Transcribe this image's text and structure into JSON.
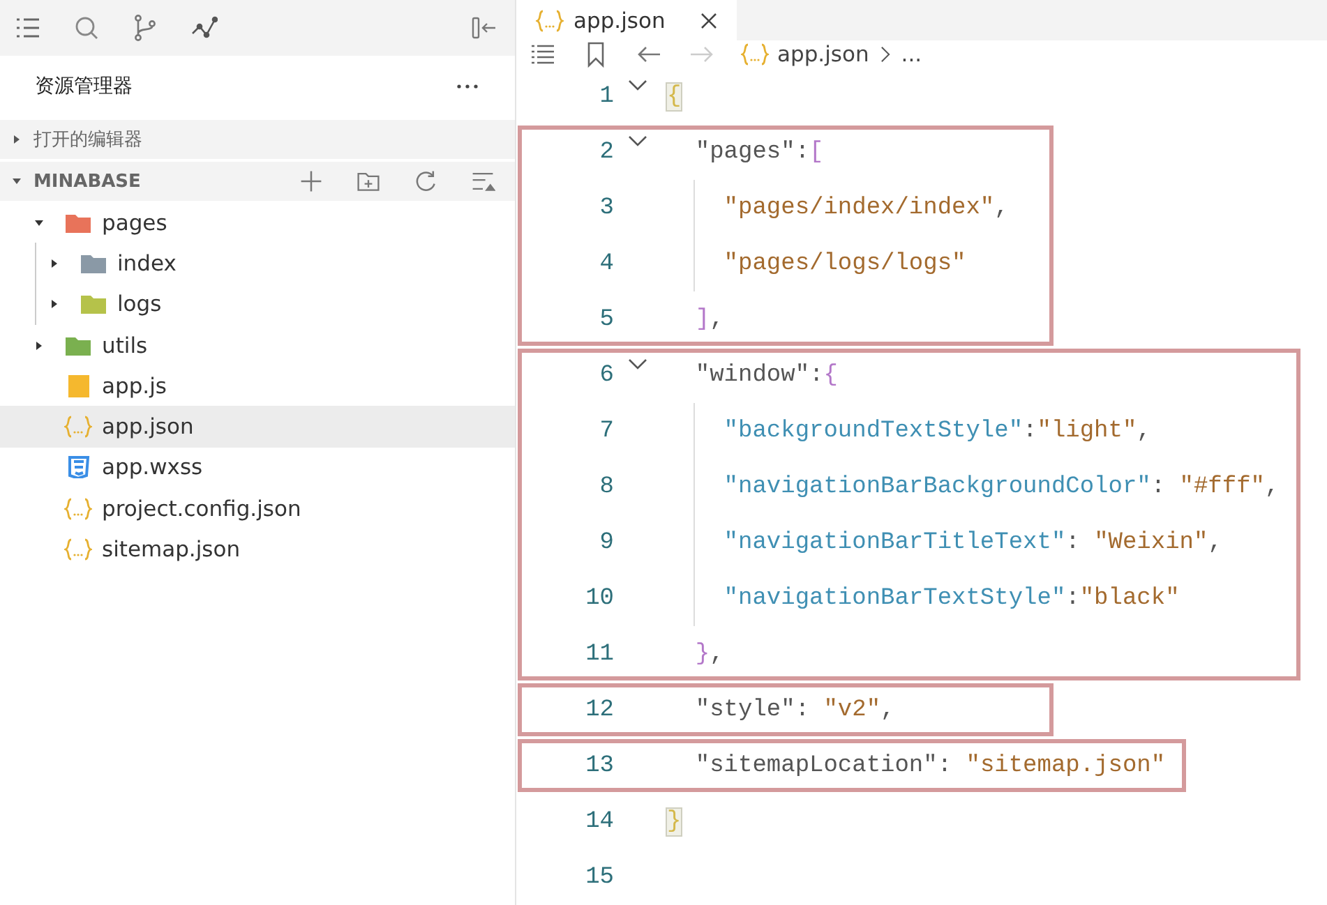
{
  "explorer": {
    "title": "资源管理器",
    "sections": [
      {
        "label": "打开的编辑器",
        "expanded": false
      },
      {
        "label": "MINABASE",
        "expanded": true
      }
    ]
  },
  "tree": [
    {
      "name": "pages",
      "kind": "folder-pages",
      "expanded": true,
      "selected": false,
      "children": [
        {
          "name": "index",
          "kind": "folder",
          "expanded": false,
          "selected": false
        },
        {
          "name": "logs",
          "kind": "folder-logs",
          "expanded": false,
          "selected": false
        }
      ]
    },
    {
      "name": "utils",
      "kind": "folder-utils",
      "expanded": false,
      "selected": false
    },
    {
      "name": "app.js",
      "kind": "js",
      "selected": false
    },
    {
      "name": "app.json",
      "kind": "json",
      "selected": true
    },
    {
      "name": "app.wxss",
      "kind": "css",
      "selected": false
    },
    {
      "name": "project.config.json",
      "kind": "json",
      "selected": false
    },
    {
      "name": "sitemap.json",
      "kind": "json",
      "selected": false
    }
  ],
  "tabs": [
    {
      "label": "app.json",
      "kind": "json",
      "selected": true
    }
  ],
  "breadcrumb": {
    "file": "app.json",
    "kind": "json",
    "tail": "..."
  },
  "code": {
    "blocks": [
      {
        "highlighted": false,
        "lines": [
          {
            "number": "1",
            "foldable": true,
            "indent_guide": false,
            "tokens": [
              {
                "kind": "bracket-match",
                "text": "{"
              }
            ]
          }
        ]
      },
      {
        "highlighted": true,
        "lines": [
          {
            "number": "2",
            "foldable": true,
            "indent_guide": false,
            "tokens": [
              {
                "kind": "key",
                "text": "  \"pages\""
              },
              {
                "kind": "punct",
                "text": ":"
              },
              {
                "kind": "bracket",
                "text": "["
              }
            ]
          },
          {
            "number": "3",
            "foldable": false,
            "indent_guide": true,
            "tokens": [
              {
                "kind": "string",
                "text": "    \"pages/index/index\""
              },
              {
                "kind": "punct",
                "text": ","
              }
            ]
          },
          {
            "number": "4",
            "foldable": false,
            "indent_guide": true,
            "tokens": [
              {
                "kind": "string",
                "text": "    \"pages/logs/logs\""
              }
            ]
          },
          {
            "number": "5",
            "foldable": false,
            "indent_guide": false,
            "tokens": [
              {
                "kind": "bracket",
                "text": "  ]"
              },
              {
                "kind": "punct",
                "text": ","
              }
            ]
          }
        ]
      },
      {
        "highlighted": true,
        "lines": [
          {
            "number": "6",
            "foldable": true,
            "indent_guide": false,
            "tokens": [
              {
                "kind": "key",
                "text": "  \"window\""
              },
              {
                "kind": "punct",
                "text": ":"
              },
              {
                "kind": "bracket",
                "text": "{"
              }
            ]
          },
          {
            "number": "7",
            "foldable": false,
            "indent_guide": true,
            "tokens": [
              {
                "kind": "prop",
                "text": "    \"backgroundTextStyle\""
              },
              {
                "kind": "punct",
                "text": ":"
              },
              {
                "kind": "string",
                "text": "\"light\""
              },
              {
                "kind": "punct",
                "text": ","
              }
            ]
          },
          {
            "number": "8",
            "foldable": false,
            "indent_guide": true,
            "tokens": [
              {
                "kind": "prop",
                "text": "    \"navigationBarBackgroundColor\""
              },
              {
                "kind": "punct",
                "text": ": "
              },
              {
                "kind": "string",
                "text": "\"#fff\""
              },
              {
                "kind": "punct",
                "text": ","
              }
            ]
          },
          {
            "number": "9",
            "foldable": false,
            "indent_guide": true,
            "tokens": [
              {
                "kind": "prop",
                "text": "    \"navigationBarTitleText\""
              },
              {
                "kind": "punct",
                "text": ": "
              },
              {
                "kind": "string",
                "text": "\"Weixin\""
              },
              {
                "kind": "punct",
                "text": ","
              }
            ]
          },
          {
            "number": "10",
            "foldable": false,
            "indent_guide": true,
            "tokens": [
              {
                "kind": "prop",
                "text": "    \"navigationBarTextStyle\""
              },
              {
                "kind": "punct",
                "text": ":"
              },
              {
                "kind": "string",
                "text": "\"black\""
              }
            ]
          },
          {
            "number": "11",
            "foldable": false,
            "indent_guide": false,
            "tokens": [
              {
                "kind": "bracket",
                "text": "  }"
              },
              {
                "kind": "punct",
                "text": ","
              }
            ]
          }
        ]
      },
      {
        "highlighted": true,
        "lines": [
          {
            "number": "12",
            "foldable": false,
            "indent_guide": false,
            "tokens": [
              {
                "kind": "key",
                "text": "  \"style\""
              },
              {
                "kind": "punct",
                "text": ": "
              },
              {
                "kind": "string",
                "text": "\"v2\""
              },
              {
                "kind": "punct",
                "text": ","
              }
            ]
          }
        ]
      },
      {
        "highlighted": true,
        "lines": [
          {
            "number": "13",
            "foldable": false,
            "indent_guide": false,
            "tokens": [
              {
                "kind": "key",
                "text": "  \"sitemapLocation\""
              },
              {
                "kind": "punct",
                "text": ": "
              },
              {
                "kind": "string",
                "text": "\"sitemap.json\""
              }
            ]
          }
        ]
      },
      {
        "highlighted": false,
        "lines": [
          {
            "number": "14",
            "foldable": false,
            "indent_guide": false,
            "tokens": [
              {
                "kind": "bracket-match",
                "text": "}"
              }
            ]
          },
          {
            "number": "15",
            "foldable": false,
            "indent_guide": false
          }
        ]
      }
    ]
  }
}
